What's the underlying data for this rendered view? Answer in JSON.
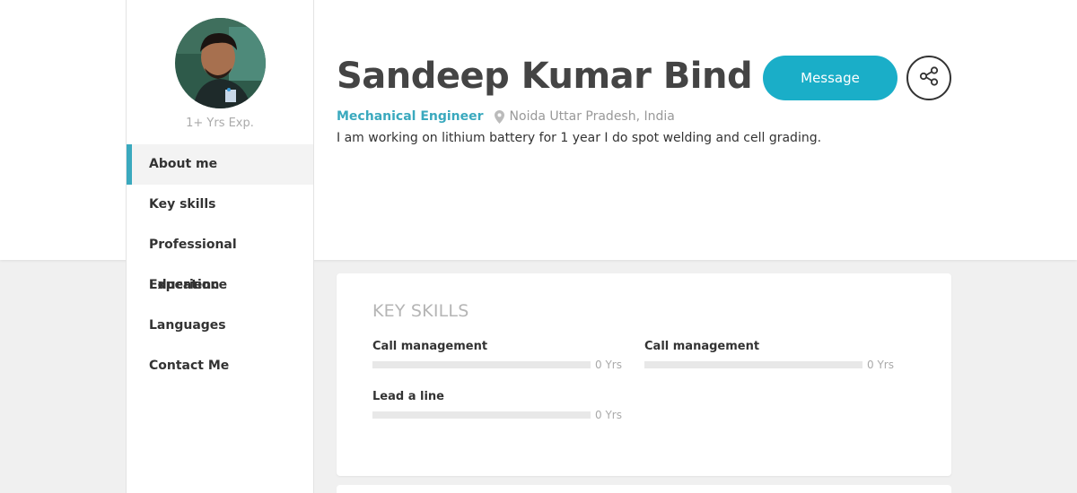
{
  "profile": {
    "name": "Sandeep Kumar Bind",
    "job_title": "Mechanical Engineer",
    "location": "Noida Uttar Pradesh, India",
    "bio": "I am working on lithium battery for 1 year I do spot welding and cell grading.",
    "experience": "1+ Yrs Exp."
  },
  "actions": {
    "message_label": "Message",
    "share_icon": "share-icon"
  },
  "sidebar": {
    "items": [
      {
        "label": "About me",
        "active": true
      },
      {
        "label": "Key skills",
        "active": false
      },
      {
        "label": "Professional Experience",
        "active": false
      },
      {
        "label": "Education",
        "active": false
      },
      {
        "label": "Languages",
        "active": false
      },
      {
        "label": "Contact Me",
        "active": false
      }
    ]
  },
  "key_skills": {
    "title": "KEY SKILLS",
    "skills": [
      {
        "name": "Call management",
        "years": "0 Yrs",
        "level": 0
      },
      {
        "name": "Call management",
        "years": "0 Yrs",
        "level": 0
      },
      {
        "name": "Lead a line",
        "years": "0 Yrs",
        "level": 0
      }
    ]
  },
  "colors": {
    "accent": "#1aaec8",
    "link": "#3aa9be",
    "background": "#f0f0f0"
  }
}
